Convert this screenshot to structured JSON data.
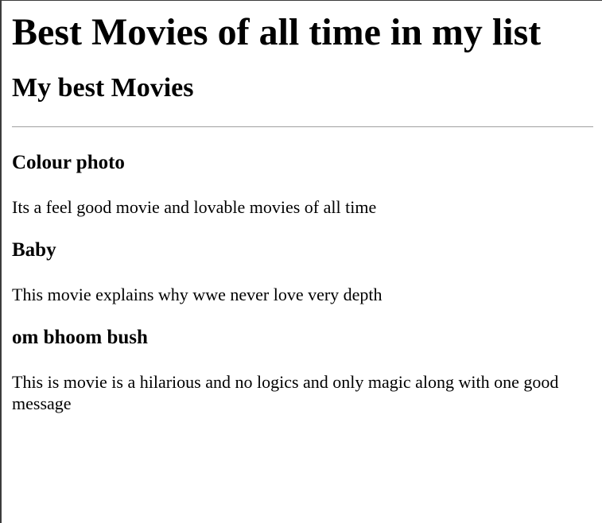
{
  "page": {
    "title": "Best Movies of all time in my list",
    "subtitle": "My best Movies"
  },
  "movies": [
    {
      "title": "Colour photo",
      "description": "Its a feel good movie and lovable movies of all time"
    },
    {
      "title": "Baby",
      "description": "This movie explains why wwe never love very depth"
    },
    {
      "title": "om bhoom bush",
      "description": "This is movie is a hilarious and no logics and only magic along with one good message"
    }
  ]
}
